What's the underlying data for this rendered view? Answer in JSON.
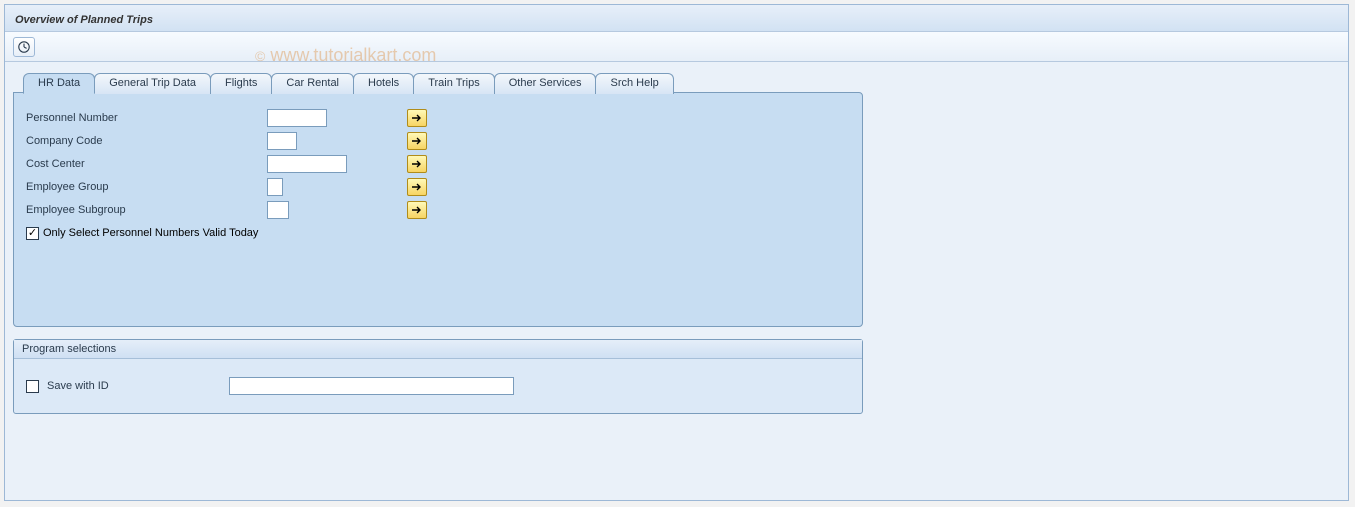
{
  "page": {
    "title": "Overview of Planned Trips"
  },
  "tabs": [
    {
      "label": "HR Data",
      "active": true
    },
    {
      "label": "General Trip Data",
      "active": false
    },
    {
      "label": "Flights",
      "active": false
    },
    {
      "label": "Car Rental",
      "active": false
    },
    {
      "label": "Hotels",
      "active": false
    },
    {
      "label": "Train Trips",
      "active": false
    },
    {
      "label": "Other Services",
      "active": false
    },
    {
      "label": "Srch Help",
      "active": false
    }
  ],
  "hr_data": {
    "personnel_number": {
      "label": "Personnel Number",
      "value": ""
    },
    "company_code": {
      "label": "Company Code",
      "value": ""
    },
    "cost_center": {
      "label": "Cost Center",
      "value": ""
    },
    "employee_group": {
      "label": "Employee Group",
      "value": ""
    },
    "employee_subgroup": {
      "label": "Employee Subgroup",
      "value": ""
    },
    "only_valid_today": {
      "label": "Only Select Personnel Numbers Valid Today",
      "checked": true
    }
  },
  "program_selections": {
    "header": "Program selections",
    "save_with_id": {
      "label": "Save with ID",
      "checked": false,
      "value": ""
    }
  },
  "watermark": "© www.tutorialkart.com",
  "icons": {
    "execute": "execute-clock-icon",
    "multiple_selection": "arrow-right-icon"
  }
}
